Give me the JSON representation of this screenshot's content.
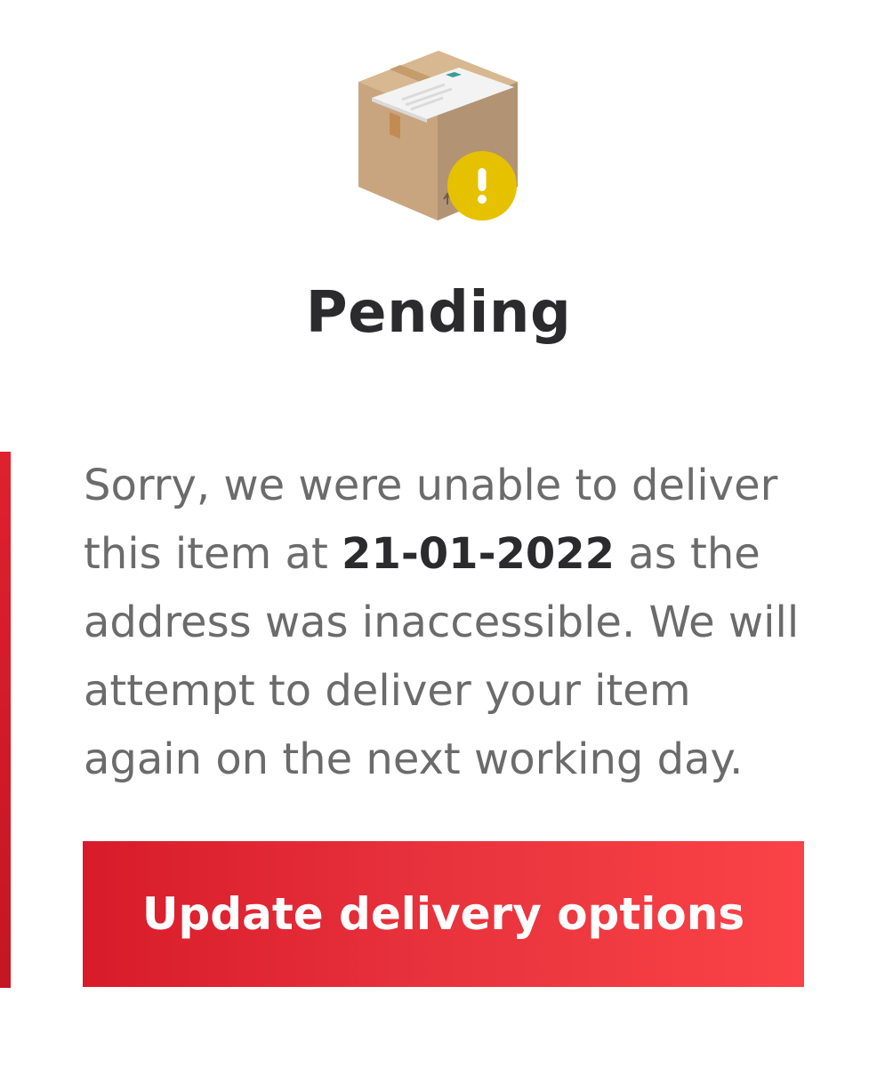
{
  "status": {
    "icon": "package-warning-icon",
    "title": "Pending"
  },
  "message": {
    "before_date": "Sorry, we were unable to deliver this item at ",
    "date": "21-01-2022",
    "after_date": " as the address was inaccessible. We will attempt to deliver your item again on the next working day."
  },
  "actions": {
    "update_label": "Update delivery options"
  },
  "colors": {
    "accent_red": "#e0202f",
    "button_gradient_start": "#d81b2a",
    "button_gradient_end": "#fa4347",
    "warning_yellow": "#e6c100",
    "title_text": "#2b2b2e",
    "body_text": "#6b6b6b"
  }
}
